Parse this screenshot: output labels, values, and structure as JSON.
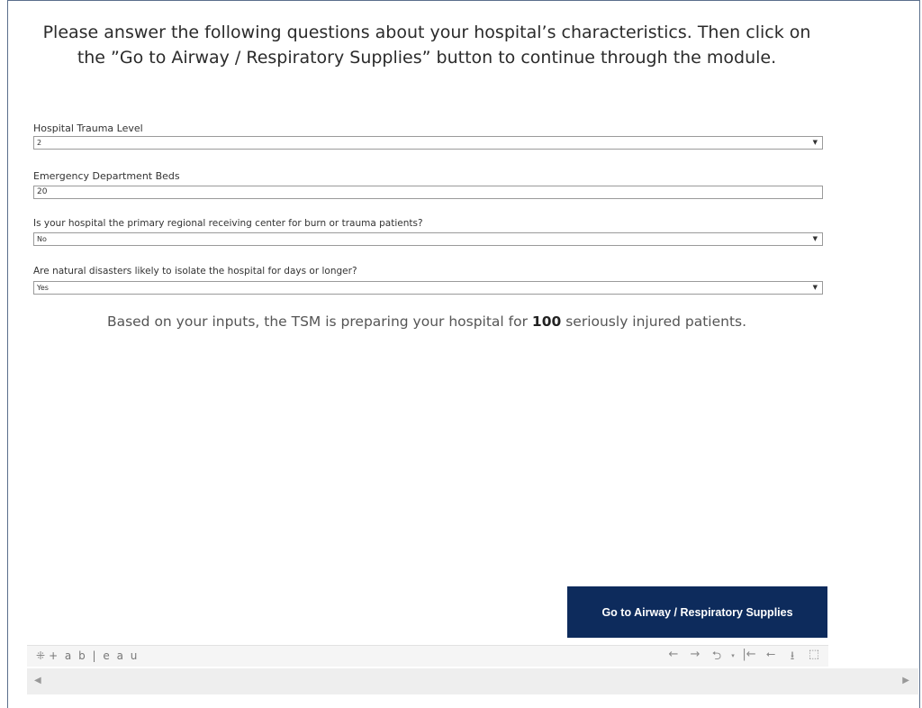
{
  "intro": {
    "text": "Please answer the following questions about your hospital’s characteristics. Then click on the ”Go to Airway / Respiratory Supplies” button to continue through the module."
  },
  "fields": [
    {
      "label": "Hospital Trauma Level",
      "value": "2",
      "type": "select"
    },
    {
      "label": "Emergency Department Beds",
      "value": "20",
      "type": "input"
    },
    {
      "label": "Is your hospital the primary regional receiving center for burn or trauma patients?",
      "value": "No",
      "type": "select"
    },
    {
      "label": "Are natural disasters likely to isolate the hospital for days or longer?",
      "value": "Yes",
      "type": "select"
    }
  ],
  "result": {
    "before": "Based on your inputs, the TSM is preparing your hospital for ",
    "count": "100",
    "after": " seriously injured patients."
  },
  "button": {
    "label": "Go to Airway / Respiratory Supplies"
  },
  "toolbar": {
    "logo_text": "+ a b | e a u",
    "undo_icon": "←",
    "redo_icon": "→",
    "revert_icon": "⮌",
    "dropdown_icon": "▾",
    "reset_icon": "|←",
    "share_icon": "⭠",
    "download_icon": "⭳",
    "fullscreen_icon": "⬚"
  },
  "scroll": {
    "left_icon": "◀",
    "right_icon": "▶"
  },
  "colors": {
    "button_bg": "#0d2b5c",
    "button_text": "#ffffff"
  }
}
